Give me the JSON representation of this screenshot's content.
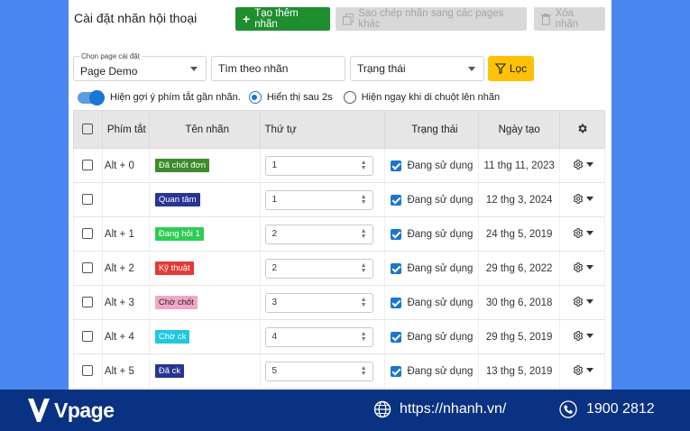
{
  "header": {
    "title": "Cài đặt nhãn hội thoại",
    "create_label": "Tạo thêm nhãn",
    "copy_label": "Sao chép nhãn sang các pages khác",
    "delete_label": "Xóa nhãn"
  },
  "filters": {
    "page_label": "Chọn page cài đặt",
    "page_value": "Page Demo",
    "search_placeholder": "Tìm theo nhãn",
    "status_placeholder": "Trạng thái",
    "filter_label": "Lọc"
  },
  "options": {
    "toggle_label": "Hiện gợi ý phím tắt gần nhãn.",
    "radio1_label": "Hiển thị sau 2s",
    "radio2_label": "Hiện ngay khi di chuột lên nhãn"
  },
  "table": {
    "headers": [
      "",
      "Phím tắt",
      "Tên nhãn",
      "Thứ tự",
      "Trạng thái",
      "Ngày tạo",
      ""
    ],
    "rows": [
      {
        "shortcut": "Alt + 0",
        "name": "Đã chốt đơn",
        "tag_bg": "#3d8b2a",
        "order": "1",
        "status": "Đang sử dụng",
        "date": "11 thg 11, 2023"
      },
      {
        "shortcut": "",
        "name": "Quan tâm",
        "tag_bg": "#283593",
        "order": "1",
        "status": "Đang sử dụng",
        "date": "12 thg 3, 2024"
      },
      {
        "shortcut": "Alt + 1",
        "name": "Đang hỏi 1",
        "tag_bg": "#2ecc55",
        "order": "2",
        "status": "Đang sử dụng",
        "date": "24 thg 5, 2019"
      },
      {
        "shortcut": "Alt + 2",
        "name": "Kỹ thuật",
        "tag_bg": "#e53935",
        "order": "2",
        "status": "Đang sử dụng",
        "date": "29 thg 6, 2022"
      },
      {
        "shortcut": "Alt + 3",
        "name": "Chờ chốt",
        "tag_bg": "#f4a6c8",
        "tag_color": "#222",
        "order": "3",
        "status": "Đang sử dụng",
        "date": "30 thg 6, 2018"
      },
      {
        "shortcut": "Alt + 4",
        "name": "Chờ ck",
        "tag_bg": "#1ec8e0",
        "order": "4",
        "status": "Đang sử dụng",
        "date": "29 thg 5, 2019"
      },
      {
        "shortcut": "Alt + 5",
        "name": "Đã ck",
        "tag_bg": "#283593",
        "order": "5",
        "status": "Đang sử dụng",
        "date": "13 thg 5, 2019"
      }
    ]
  },
  "footer": {
    "brand": "Vpage",
    "website": "https://nhanh.vn/",
    "phone": "1900 2812"
  }
}
